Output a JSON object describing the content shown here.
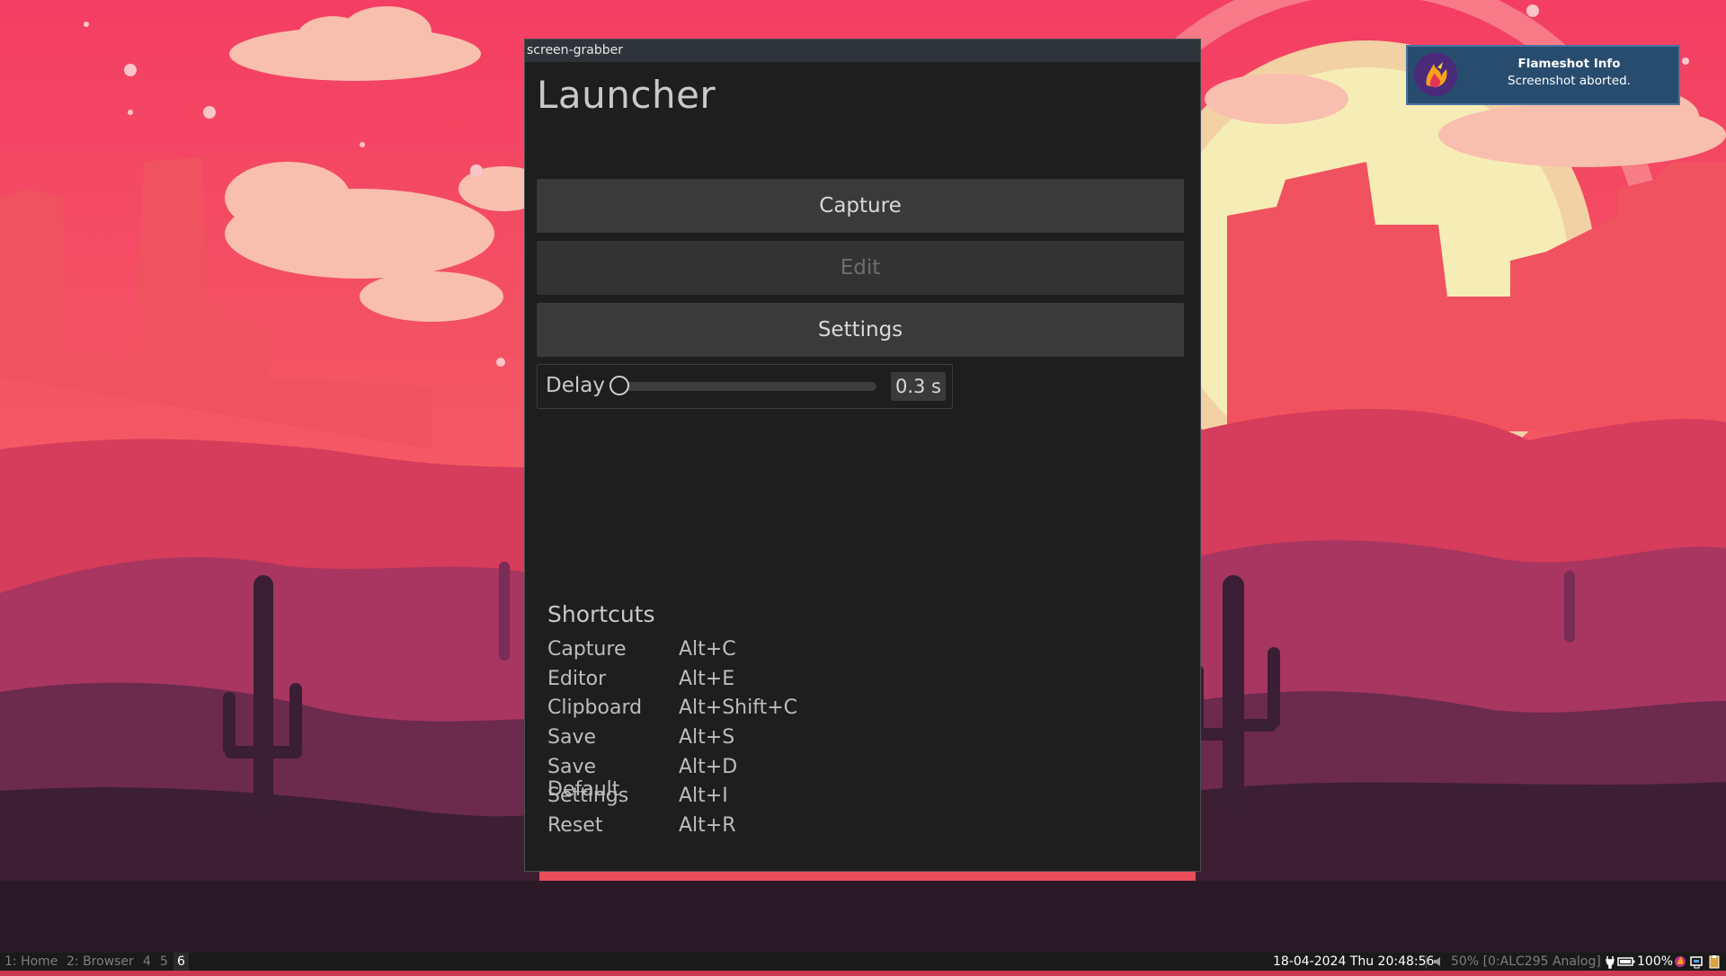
{
  "window": {
    "title": "screen-grabber",
    "heading": "Launcher",
    "buttons": {
      "capture": "Capture",
      "edit": "Edit",
      "settings": "Settings"
    },
    "delay": {
      "label": "Delay",
      "value": "0.3 s",
      "fraction": 0.0
    },
    "shortcuts": {
      "title": "Shortcuts",
      "items": [
        {
          "name": "Capture",
          "key": "Alt+C"
        },
        {
          "name": "Editor",
          "key": "Alt+E"
        },
        {
          "name": "Clipboard",
          "key": "Alt+Shift+C"
        },
        {
          "name": "Save",
          "key": "Alt+S"
        },
        {
          "name": "Save Default",
          "key": "Alt+D"
        },
        {
          "name": "Settings",
          "key": "Alt+I"
        },
        {
          "name": "Reset",
          "key": "Alt+R"
        }
      ]
    }
  },
  "notification": {
    "title": "Flameshot Info",
    "body": "Screenshot aborted.",
    "icon": "flameshot-icon"
  },
  "taskbar": {
    "workspaces": [
      "1: Home",
      "2: Browser",
      "4",
      "5",
      "6"
    ],
    "active_workspace": "6",
    "datetime": "18-04-2024 Thu 20:48:56",
    "volume": "50% [0:ALC295 Analog]",
    "battery": "100%",
    "icons": [
      "volume-icon",
      "power-plug-icon",
      "battery-icon",
      "flameshot-tray-icon",
      "network-icon",
      "clipboard-icon"
    ]
  },
  "colors": {
    "sky": "#f04a6a",
    "sun": "#f6edb6",
    "window_bg": "#1e1e1e",
    "button_bg": "#3a3a3a",
    "notification_bg": "#284c6e"
  }
}
